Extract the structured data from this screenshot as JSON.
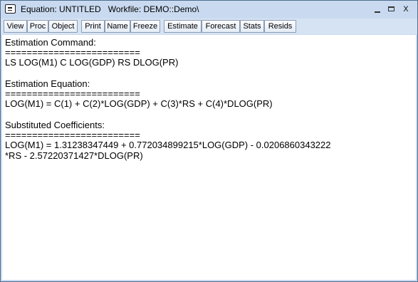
{
  "window": {
    "title_object": "Equation: UNTITLED",
    "title_workfile": "Workfile: DEMO::Demo\\",
    "controls": {
      "minimize": "_",
      "maximize": "□",
      "close": "x"
    }
  },
  "toolbar": {
    "buttons": [
      "View",
      "Proc",
      "Object",
      "Print",
      "Name",
      "Freeze",
      "Estimate",
      "Forecast",
      "Stats",
      "Resids"
    ]
  },
  "output": {
    "command_heading": "Estimation Command:",
    "command_rule": "=========================",
    "command": "LS LOG(M1) C LOG(GDP) RS DLOG(PR)",
    "equation_heading": "Estimation Equation:",
    "equation_rule": "=========================",
    "equation": "LOG(M1) = C(1) + C(2)*LOG(GDP) + C(3)*RS + C(4)*DLOG(PR)",
    "substituted_heading": "Substituted Coefficients:",
    "substituted_rule": "=========================",
    "substituted_line1": "LOG(M1) = 1.31238347449 + 0.772034899215*LOG(GDP) - 0.0206860343222",
    "substituted_line2": "*RS - 2.57220371427*DLOG(PR)"
  },
  "colors": {
    "titlebar": "#c9daf0",
    "toolbar": "#d6e3f3",
    "border": "#4f6f8f",
    "content_bg": "#ffffff"
  }
}
